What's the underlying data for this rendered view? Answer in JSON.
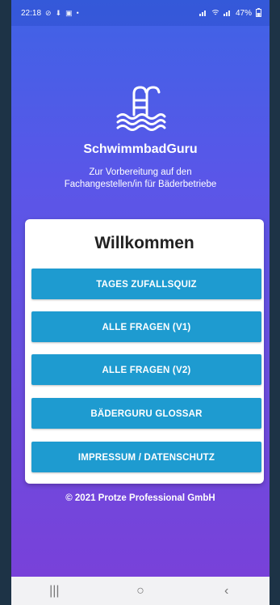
{
  "status_bar": {
    "time": "22:18",
    "left_icons": [
      "do-not-disturb-icon",
      "download-icon",
      "image-icon",
      "dot-icon"
    ],
    "battery": "47%"
  },
  "app": {
    "name": "SchwimmbadGuru",
    "subtitle_line1": "Zur Vorbereitung auf den",
    "subtitle_line2": "Fachangestellen/in für Bäderbetriebe",
    "logo_icon": "pool-ladder-icon"
  },
  "card": {
    "title": "Willkommen",
    "buttons": [
      {
        "label": "TAGES ZUFALLSQUIZ"
      },
      {
        "label": "ALLE FRAGEN (V1)"
      },
      {
        "label": "ALLE FRAGEN (V2)"
      },
      {
        "label": "BÄDERGURU GLOSSAR"
      },
      {
        "label": "IMPRESSUM / DATENSCHUTZ"
      }
    ]
  },
  "footer": {
    "copyright": "© 2021 Protze Professional GmbH"
  },
  "nav": {
    "recents": "|||",
    "home": "○",
    "back": "‹"
  },
  "colors": {
    "button": "#1e9bd0",
    "gradient_top": "#3f63e6",
    "gradient_bottom": "#7a3fd8"
  }
}
